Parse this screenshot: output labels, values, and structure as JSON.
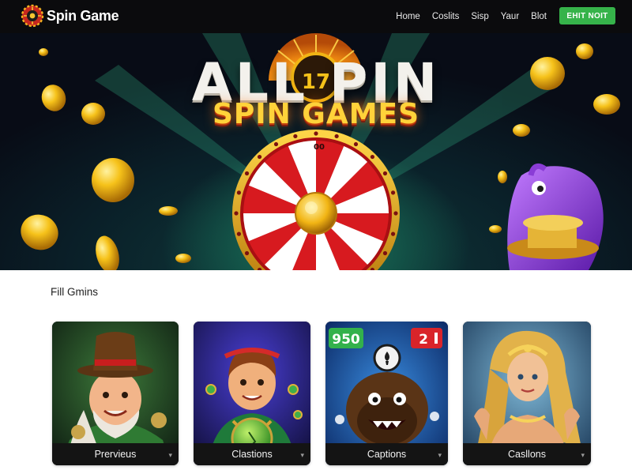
{
  "nav": {
    "brand": "Spin Game",
    "items": [
      "Home",
      "Coslits",
      "Sisp",
      "Yaur",
      "Blot"
    ],
    "cta_label": "EHIT NOIT",
    "icons": {
      "brand": "roulette-wheel-icon"
    }
  },
  "hero": {
    "title_line1": "ALL PIN",
    "wheel_number": "17",
    "title_line2": "SPIN GAMES",
    "wheel_label": "00"
  },
  "section": {
    "title": "Fill Gmins"
  },
  "cards": [
    {
      "caption": "Prervieus",
      "art": "leprechaun-character"
    },
    {
      "caption": "Clastions",
      "art": "boy-with-green-plate"
    },
    {
      "caption": "Captions",
      "art": "furry-monster",
      "badges": [
        "950",
        "2"
      ]
    },
    {
      "caption": "Casllons",
      "art": "golden-goddess"
    }
  ],
  "colors": {
    "nav_bg": "#0b0b0d",
    "cta": "#36b34a",
    "caption_bg": "#141414",
    "gold": "#ffc21f"
  }
}
